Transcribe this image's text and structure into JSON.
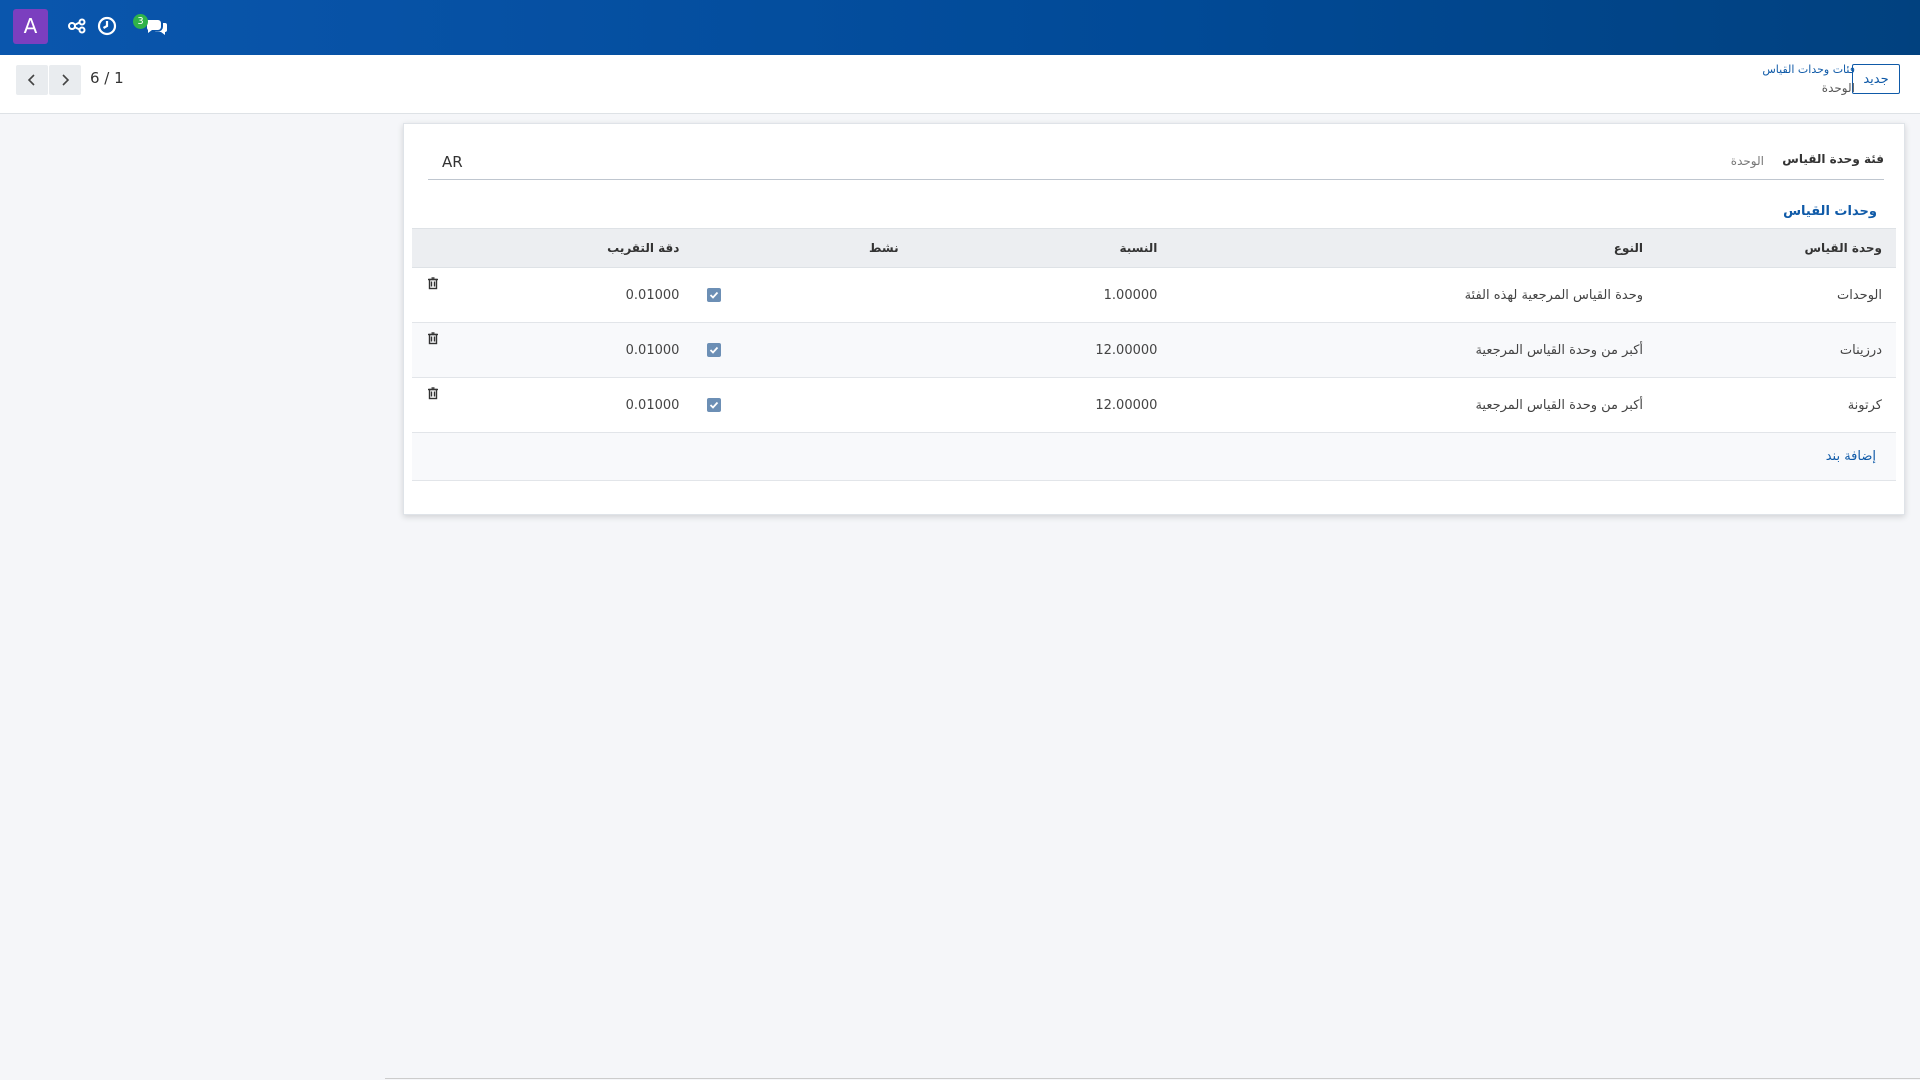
{
  "navbar": {
    "avatar_letter": "A",
    "icons": [
      "connections-icon",
      "clock-icon",
      "chat-icon"
    ],
    "chat_badge": "3",
    "colors": {
      "bar": "#0a56ad",
      "avatar": "#7b3fbf",
      "badge": "#2fb34a"
    }
  },
  "control_panel": {
    "new_button": "جديد",
    "breadcrumb_parent": "فئات وحدات القياس",
    "breadcrumb_current": "الوحدة",
    "pager": "6 / 1"
  },
  "form": {
    "category_label": "فئة وحدة القياس",
    "category_value": "AR",
    "category_placeholder": "الوحدة",
    "tab_label": "وحدات القياس"
  },
  "table": {
    "headers": {
      "uom": "وحدة القياس",
      "type": "النوع",
      "ratio": "النسبة",
      "active": "نشط",
      "rounding": "دقة التقريب"
    },
    "rows": [
      {
        "uom": "الوحدات",
        "type": "وحدة القياس المرجعية لهذه الفئة",
        "ratio": "1.00000",
        "active": true,
        "rounding": "0.01000"
      },
      {
        "uom": "درزينات",
        "type": "أكبر من وحدة القياس المرجعية",
        "ratio": "12.00000",
        "active": true,
        "rounding": "0.01000"
      },
      {
        "uom": "كرتونة",
        "type": "أكبر من وحدة القياس المرجعية",
        "ratio": "12.00000",
        "active": true,
        "rounding": "0.01000"
      }
    ],
    "add_line": "إضافة بند"
  }
}
